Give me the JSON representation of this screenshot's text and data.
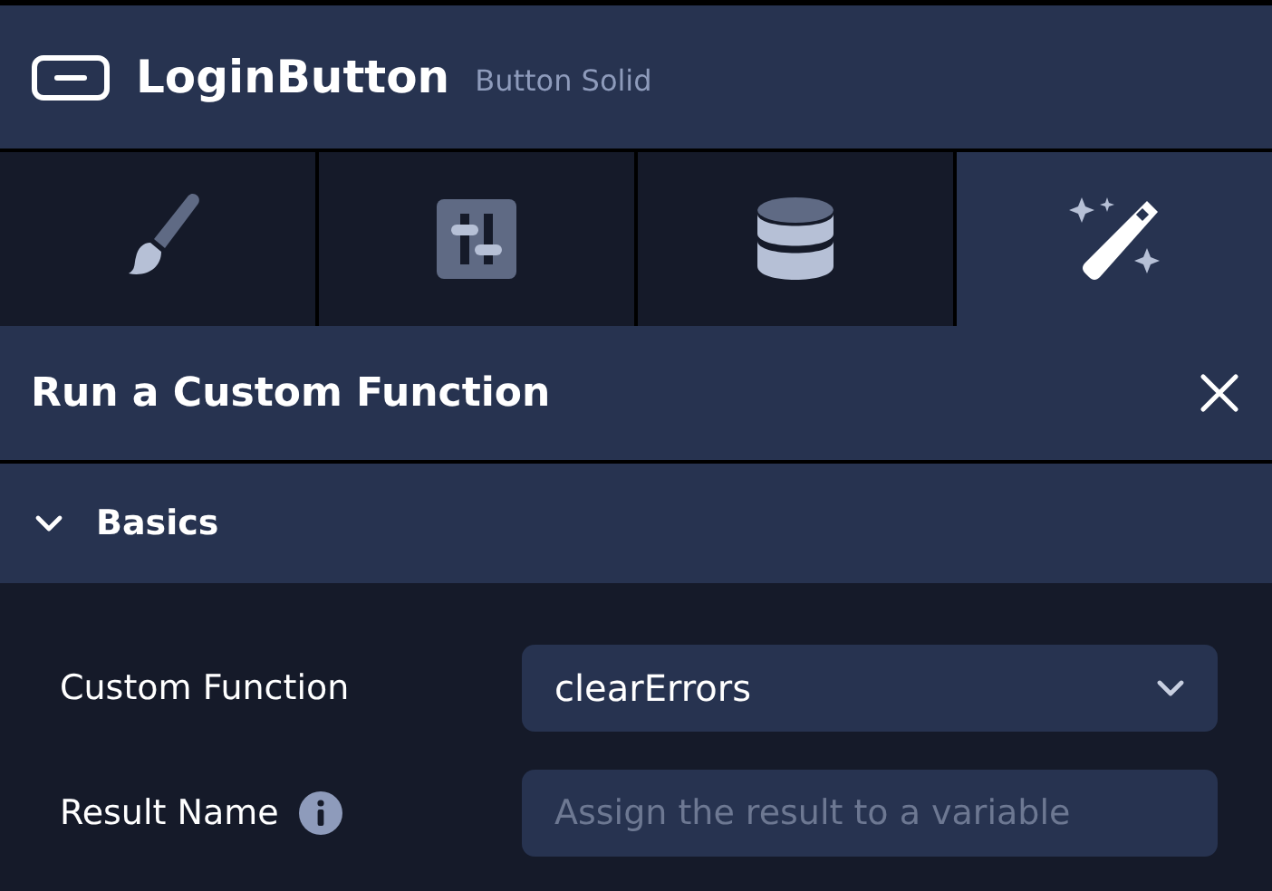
{
  "header": {
    "title": "LoginButton",
    "subtitle": "Button Solid"
  },
  "tabs": [
    {
      "kind": "brush",
      "selected": false
    },
    {
      "kind": "sliders",
      "selected": false
    },
    {
      "kind": "database",
      "selected": false
    },
    {
      "kind": "magic",
      "selected": true
    }
  ],
  "panel": {
    "title": "Run a Custom Function"
  },
  "section": {
    "title": "Basics",
    "expanded": true
  },
  "fields": [
    {
      "kind": "select",
      "label": "Custom Function",
      "value": "clearErrors"
    },
    {
      "kind": "input",
      "label": "Result Name",
      "info": true,
      "placeholder": "Assign the result to a variable"
    }
  ]
}
